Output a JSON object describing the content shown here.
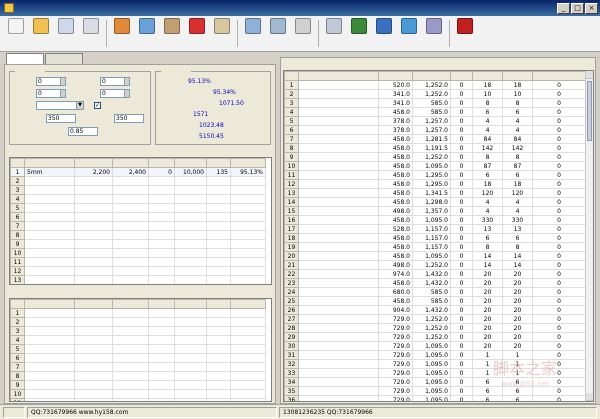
{
  "window": {
    "title": "",
    "controls": [
      "_",
      "□",
      "×"
    ]
  },
  "toolbar": {
    "buttons": [
      {
        "id": "new",
        "label": "",
        "color": "#f4f4f4"
      },
      {
        "id": "open",
        "label": "",
        "color": "#f0c050"
      },
      {
        "id": "save",
        "label": "",
        "color": "#cfd8e8"
      },
      {
        "id": "save-as",
        "label": "",
        "color": "#d8dce4"
      },
      {
        "id": "get-data",
        "label": "",
        "color": "#e08a3a"
      },
      {
        "id": "insert-row",
        "label": "",
        "color": "#6aa0d8"
      },
      {
        "id": "move-row",
        "label": "",
        "color": "#c0a070"
      },
      {
        "id": "clear-rows",
        "label": "",
        "color": "#d83030"
      },
      {
        "id": "optimize",
        "label": "",
        "color": "#d8c8a0"
      },
      {
        "id": "preview",
        "label": "",
        "color": "#8fb0d8"
      },
      {
        "id": "data-manage",
        "label": "",
        "color": "#a0b8d0"
      },
      {
        "id": "import-disabled",
        "label": "",
        "color": "#d0d0d0"
      },
      {
        "id": "settings",
        "label": "",
        "color": "#c0c8d8"
      },
      {
        "id": "online-help",
        "label": "",
        "color": "#3a8a3a"
      },
      {
        "id": "online-update",
        "label": "",
        "color": "#3a70c0"
      },
      {
        "id": "online-purchase",
        "label": "",
        "color": "#4a9ad8"
      },
      {
        "id": "about",
        "label": "",
        "color": "#9a9ac8"
      },
      {
        "id": "exit",
        "label": "",
        "color": "#c02020"
      }
    ]
  },
  "tabs": [
    {
      "label": "",
      "active": true
    },
    {
      "label": "",
      "active": false
    }
  ],
  "settings": {
    "section_title": "",
    "rows": [
      {
        "label": "",
        "value": "0"
      },
      {
        "label": "",
        "value": "0"
      },
      {
        "label": "",
        "value": "0"
      },
      {
        "label": "",
        "value": "0"
      }
    ],
    "method_label": "",
    "method_value": "",
    "checkbox_label": "",
    "checkbox_checked": true,
    "length_label_1": "",
    "length_value_1": "350",
    "length_label_2": "",
    "length_value_2": "350",
    "length_label_3": "",
    "length_value_3": "0.85"
  },
  "results": {
    "section_title": "",
    "items": [
      {
        "label": "",
        "value": "95.13%"
      },
      {
        "label": "",
        "value": "95.34%"
      },
      {
        "label": "",
        "value": "1071.50"
      },
      {
        "label": "",
        "value": "1571"
      },
      {
        "label": "",
        "value": "1023.48"
      },
      {
        "label": "",
        "value": "5150.45"
      }
    ]
  },
  "material_table": {
    "section_title": "",
    "columns": [
      "",
      "",
      "",
      "",
      "",
      "",
      "",
      ""
    ],
    "rows": [
      {
        "no": "1",
        "name": "5mm",
        "length": "2,200",
        "width": "2,400",
        "thickness": "0",
        "qty": "10,000",
        "usage": "135",
        "rate": "95.13%"
      },
      {
        "no": "2",
        "name": "",
        "length": "",
        "width": "",
        "thickness": "",
        "qty": "",
        "usage": "",
        "rate": ""
      },
      {
        "no": "3",
        "name": "",
        "length": "",
        "width": "",
        "thickness": "",
        "qty": "",
        "usage": "",
        "rate": ""
      },
      {
        "no": "4",
        "name": "",
        "length": "",
        "width": "",
        "thickness": "",
        "qty": "",
        "usage": "",
        "rate": ""
      },
      {
        "no": "5",
        "name": "",
        "length": "",
        "width": "",
        "thickness": "",
        "qty": "",
        "usage": "",
        "rate": ""
      },
      {
        "no": "6",
        "name": "",
        "length": "",
        "width": "",
        "thickness": "",
        "qty": "",
        "usage": "",
        "rate": ""
      },
      {
        "no": "7",
        "name": "",
        "length": "",
        "width": "",
        "thickness": "",
        "qty": "",
        "usage": "",
        "rate": ""
      },
      {
        "no": "8",
        "name": "",
        "length": "",
        "width": "",
        "thickness": "",
        "qty": "",
        "usage": "",
        "rate": ""
      },
      {
        "no": "9",
        "name": "",
        "length": "",
        "width": "",
        "thickness": "",
        "qty": "",
        "usage": "",
        "rate": ""
      },
      {
        "no": "10",
        "name": "",
        "length": "",
        "width": "",
        "thickness": "",
        "qty": "",
        "usage": "",
        "rate": ""
      },
      {
        "no": "11",
        "name": "",
        "length": "",
        "width": "",
        "thickness": "",
        "qty": "",
        "usage": "",
        "rate": ""
      },
      {
        "no": "12",
        "name": "",
        "length": "",
        "width": "",
        "thickness": "",
        "qty": "",
        "usage": "",
        "rate": ""
      },
      {
        "no": "13",
        "name": "",
        "length": "",
        "width": "",
        "thickness": "",
        "qty": "",
        "usage": "",
        "rate": ""
      }
    ]
  },
  "remnant_table": {
    "section_title": "",
    "columns": [
      "",
      "",
      "",
      "",
      "",
      "",
      "",
      ""
    ],
    "rows": [
      {
        "no": "1"
      },
      {
        "no": "2"
      },
      {
        "no": "3"
      },
      {
        "no": "4"
      },
      {
        "no": "5"
      },
      {
        "no": "6"
      },
      {
        "no": "7"
      },
      {
        "no": "8"
      },
      {
        "no": "9"
      },
      {
        "no": "10"
      },
      {
        "no": "11"
      }
    ]
  },
  "pieces_table": {
    "section_title": "",
    "columns": [
      "",
      "",
      "",
      "",
      "",
      "",
      "",
      ""
    ],
    "rows": [
      {
        "no": "1",
        "name": "",
        "length": "520.0",
        "width": "1,252.0",
        "a": "0",
        "b": "18",
        "c": "18",
        "d": "0"
      },
      {
        "no": "2",
        "name": "",
        "length": "341.0",
        "width": "1,252.0",
        "a": "0",
        "b": "10",
        "c": "10",
        "d": "0"
      },
      {
        "no": "3",
        "name": "",
        "length": "341.0",
        "width": "585.0",
        "a": "0",
        "b": "8",
        "c": "8",
        "d": "0"
      },
      {
        "no": "4",
        "name": "",
        "length": "458.0",
        "width": "585.0",
        "a": "0",
        "b": "6",
        "c": "6",
        "d": "0"
      },
      {
        "no": "5",
        "name": "",
        "length": "378.0",
        "width": "1,257.0",
        "a": "0",
        "b": "4",
        "c": "4",
        "d": "0"
      },
      {
        "no": "6",
        "name": "",
        "length": "378.0",
        "width": "1,257.0",
        "a": "0",
        "b": "4",
        "c": "4",
        "d": "0"
      },
      {
        "no": "7",
        "name": "",
        "length": "458.0",
        "width": "1,281.5",
        "a": "0",
        "b": "84",
        "c": "84",
        "d": "0"
      },
      {
        "no": "8",
        "name": "",
        "length": "458.0",
        "width": "1,191.5",
        "a": "0",
        "b": "142",
        "c": "142",
        "d": "0"
      },
      {
        "no": "9",
        "name": "",
        "length": "458.0",
        "width": "1,252.0",
        "a": "0",
        "b": "8",
        "c": "8",
        "d": "0"
      },
      {
        "no": "10",
        "name": "",
        "length": "458.0",
        "width": "1,095.0",
        "a": "0",
        "b": "87",
        "c": "87",
        "d": "0"
      },
      {
        "no": "11",
        "name": "",
        "length": "458.0",
        "width": "1,295.0",
        "a": "0",
        "b": "6",
        "c": "6",
        "d": "0"
      },
      {
        "no": "12",
        "name": "",
        "length": "458.0",
        "width": "1,295.0",
        "a": "0",
        "b": "18",
        "c": "18",
        "d": "0"
      },
      {
        "no": "13",
        "name": "",
        "length": "458.0",
        "width": "1,341.5",
        "a": "0",
        "b": "120",
        "c": "120",
        "d": "0"
      },
      {
        "no": "14",
        "name": "",
        "length": "458.0",
        "width": "1,298.0",
        "a": "0",
        "b": "4",
        "c": "4",
        "d": "0"
      },
      {
        "no": "15",
        "name": "",
        "length": "498.0",
        "width": "1,357.0",
        "a": "0",
        "b": "4",
        "c": "4",
        "d": "0"
      },
      {
        "no": "16",
        "name": "",
        "length": "458.0",
        "width": "1,095.0",
        "a": "0",
        "b": "330",
        "c": "330",
        "d": "0"
      },
      {
        "no": "17",
        "name": "",
        "length": "528.0",
        "width": "1,157.0",
        "a": "0",
        "b": "13",
        "c": "13",
        "d": "0"
      },
      {
        "no": "18",
        "name": "",
        "length": "458.0",
        "width": "1,157.0",
        "a": "0",
        "b": "6",
        "c": "6",
        "d": "0"
      },
      {
        "no": "19",
        "name": "",
        "length": "458.0",
        "width": "1,157.0",
        "a": "0",
        "b": "8",
        "c": "8",
        "d": "0"
      },
      {
        "no": "20",
        "name": "",
        "length": "458.0",
        "width": "1,095.0",
        "a": "0",
        "b": "14",
        "c": "14",
        "d": "0"
      },
      {
        "no": "21",
        "name": "",
        "length": "498.0",
        "width": "1,252.0",
        "a": "0",
        "b": "14",
        "c": "14",
        "d": "0"
      },
      {
        "no": "22",
        "name": "",
        "length": "974.0",
        "width": "1,432.0",
        "a": "0",
        "b": "20",
        "c": "20",
        "d": "0"
      },
      {
        "no": "23",
        "name": "",
        "length": "458.0",
        "width": "1,432.0",
        "a": "0",
        "b": "20",
        "c": "20",
        "d": "0"
      },
      {
        "no": "24",
        "name": "",
        "length": "680.0",
        "width": "585.0",
        "a": "0",
        "b": "20",
        "c": "20",
        "d": "0"
      },
      {
        "no": "25",
        "name": "",
        "length": "458.0",
        "width": "585.0",
        "a": "0",
        "b": "20",
        "c": "20",
        "d": "0"
      },
      {
        "no": "26",
        "name": "",
        "length": "904.0",
        "width": "1,432.0",
        "a": "0",
        "b": "20",
        "c": "20",
        "d": "0"
      },
      {
        "no": "27",
        "name": "",
        "length": "729.0",
        "width": "1,252.0",
        "a": "0",
        "b": "20",
        "c": "20",
        "d": "0"
      },
      {
        "no": "28",
        "name": "",
        "length": "729.0",
        "width": "1,252.0",
        "a": "0",
        "b": "20",
        "c": "20",
        "d": "0"
      },
      {
        "no": "29",
        "name": "",
        "length": "729.0",
        "width": "1,252.0",
        "a": "0",
        "b": "20",
        "c": "20",
        "d": "0"
      },
      {
        "no": "30",
        "name": "",
        "length": "729.0",
        "width": "1,095.0",
        "a": "0",
        "b": "20",
        "c": "20",
        "d": "0"
      },
      {
        "no": "31",
        "name": "",
        "length": "729.0",
        "width": "1,095.0",
        "a": "0",
        "b": "1",
        "c": "1",
        "d": "0"
      },
      {
        "no": "32",
        "name": "",
        "length": "729.0",
        "width": "1,095.0",
        "a": "0",
        "b": "1",
        "c": "1",
        "d": "0"
      },
      {
        "no": "33",
        "name": "",
        "length": "729.0",
        "width": "1,095.0",
        "a": "0",
        "b": "1",
        "c": "1",
        "d": "0"
      },
      {
        "no": "34",
        "name": "",
        "length": "729.0",
        "width": "1,095.0",
        "a": "0",
        "b": "6",
        "c": "6",
        "d": "0"
      },
      {
        "no": "35",
        "name": "",
        "length": "729.0",
        "width": "1,095.0",
        "a": "0",
        "b": "6",
        "c": "6",
        "d": "0"
      },
      {
        "no": "36",
        "name": "",
        "length": "729.0",
        "width": "1,095.0",
        "a": "0",
        "b": "6",
        "c": "6",
        "d": "0"
      },
      {
        "no": "37",
        "name": "",
        "length": "729.0",
        "width": "1,095.0",
        "a": "0",
        "b": "6",
        "c": "6",
        "d": "0"
      },
      {
        "no": "38",
        "name": "",
        "length": "729.0",
        "width": "1,095.0",
        "a": "0",
        "b": "6",
        "c": "6",
        "d": "0"
      }
    ]
  },
  "statusbar": {
    "cells": [
      "",
      "QQ:731679966 www.hy158.com",
      "13081236235 QQ:731679966"
    ]
  },
  "watermark": {
    "text": "脚本之家",
    "url": "www.jb51.net"
  }
}
